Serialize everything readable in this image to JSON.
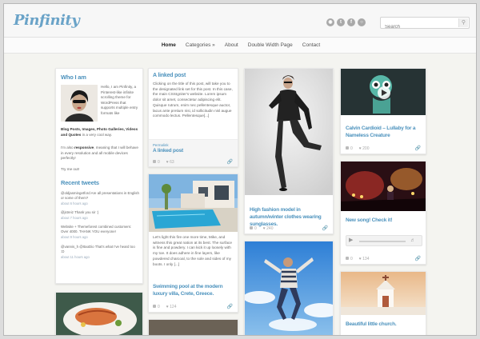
{
  "site": {
    "logo": "Pinfinity",
    "search_placeholder": "Search"
  },
  "social_icons": [
    {
      "name": "rss-icon",
      "glyph": "◉"
    },
    {
      "name": "twitter-icon",
      "glyph": "t"
    },
    {
      "name": "facebook-icon",
      "glyph": "f"
    },
    {
      "name": "dribbble-icon",
      "glyph": "○"
    }
  ],
  "nav": {
    "items": [
      "Home",
      "Categories »",
      "About",
      "Double Width Page",
      "Contact"
    ],
    "active": "Home"
  },
  "about": {
    "title": "Who I am",
    "intro": "Hello, I am Pinfinity, a Pinterest-like infinite scrolling theme for WordPress that supports multiple entry formats like",
    "formats": "Blog Posts, Images, Photo Galleries, Videos and Quotes",
    "formats_tail": "in a very cool way.",
    "responsive_pre": "I'm also",
    "responsive_bold": "responsive",
    "responsive_post": ", meaning that I will behave in every resolution and all mobile devices perfectly!",
    "try": "Try me out!"
  },
  "tweets": {
    "title": "Recent tweets",
    "items": [
      {
        "text": "@oldjasmingetford Are all presentations in English or some of them?",
        "time": "about 6 hours ago"
      },
      {
        "text": "@jstreiz Thank you sir :)",
        "time": "about 7 hours ago"
      },
      {
        "text": "Website + Themeforest combined customers: Over 4000. THANK YOU everyone!",
        "time": "about 9 hours ago"
      },
      {
        "text": "@vannis_h @ItaoDio That's what I've heard too :D",
        "time": "about 11 hours ago"
      }
    ]
  },
  "linked": {
    "title": "A linked post",
    "body": "Clicking on the title of this post, will take you to the designated link set for this post. In this case, the main CSSIgniter's website. Lorem ipsum dolor sit amet, consectetur adipiscing elit. Quisque rutrum, enim nec pellentesque auctor, lacus ante pretium nisi, id sollicitudin nisl augue commodo lectus. Pellentesque[...]",
    "permalink": "Permalink",
    "sub": "A linked post",
    "views": "0",
    "likes": "63"
  },
  "pool": {
    "body": "Let's light this fire one more time, Mike, and witness this great nation at its best. The surface is fine and powdery. I can kick it up loosely with my toe. It does adhere in fine layers, like powdered charcoal, to the sole and sides of my boots. I only [...]",
    "title": "Swimming pool at the modern luxury villa, Crete, Greece.",
    "views": "0",
    "likes": "124"
  },
  "fashion": {
    "title": "High fashion model in autumn/winter clothes wearing sunglasses.",
    "views": "0",
    "likes": "240"
  },
  "cardioid": {
    "title": "Calvin Cardioid – Lullaby for a Nameless Creature",
    "views": "0",
    "likes": "200"
  },
  "song": {
    "title": "New song! Check it!",
    "views": "0",
    "likes": "134"
  },
  "church": {
    "title": "Beautiful little church."
  },
  "colors": {
    "accent": "#4c92bd",
    "logo": "#6aa3c8"
  }
}
